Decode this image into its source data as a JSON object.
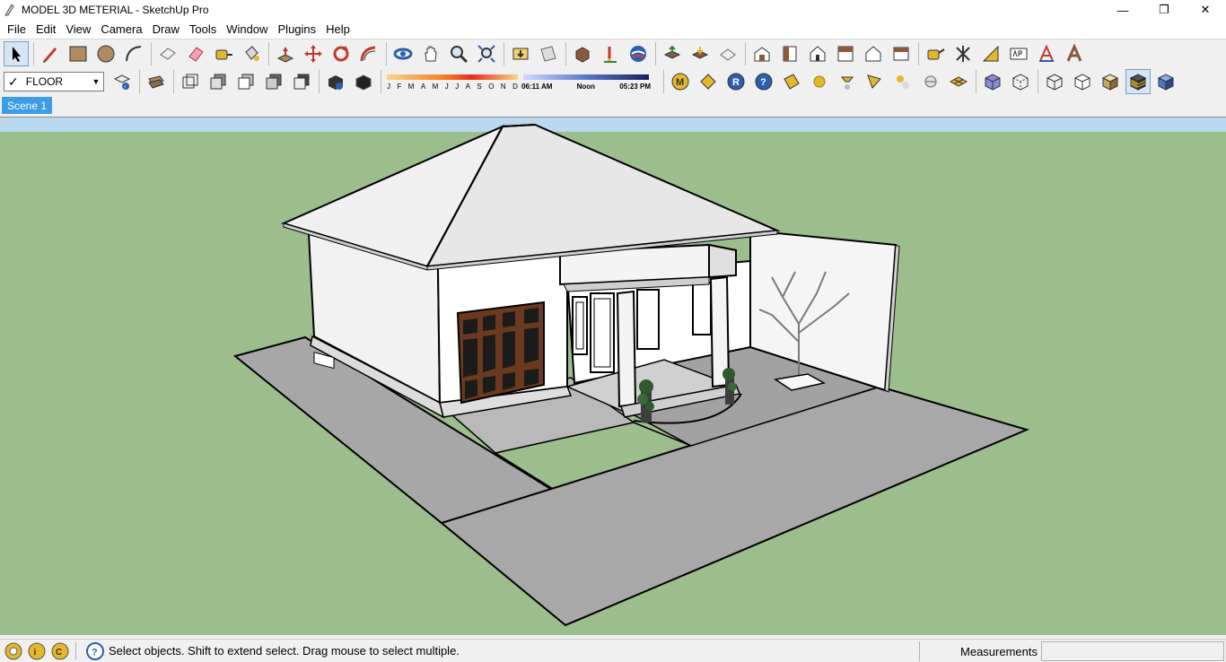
{
  "window": {
    "title": "MODEL 3D METERIAL - SketchUp Pro",
    "app_icon": "sketchup-logo-icon",
    "controls": [
      "minimize-icon",
      "restore-icon",
      "close-icon"
    ]
  },
  "menu": [
    "File",
    "Edit",
    "View",
    "Camera",
    "Draw",
    "Tools",
    "Window",
    "Plugins",
    "Help"
  ],
  "toolbar1": [
    "select-arrow-icon",
    "pencil-icon",
    "rectangle-icon",
    "circle-icon",
    "arc-icon",
    "make-component-icon",
    "eraser-icon",
    "tape-measure-icon",
    "paint-bucket-icon",
    "push-pull-icon",
    "move-icon",
    "rotate-icon",
    "follow-me-icon",
    "orbit-icon",
    "pan-icon",
    "zoom-icon",
    "zoom-extents-icon",
    "get-models-icon",
    "share-model-icon",
    "3d-warehouse-icon",
    "text-icon",
    "google-earth-icon",
    "upload-icon",
    "download-icon",
    "preview-icon",
    "iso-view-icon",
    "front-view-icon",
    "right-view-icon",
    "back-view-icon",
    "left-view-icon",
    "top-view-icon",
    "dimension-icon",
    "axes-icon",
    "protractor-icon",
    "3d-text-icon",
    "section-icon",
    "label-icon"
  ],
  "layer": {
    "current": "FLOOR"
  },
  "shadow": {
    "months": [
      "J",
      "F",
      "M",
      "A",
      "M",
      "J",
      "J",
      "A",
      "S",
      "O",
      "N",
      "D"
    ],
    "time_start": "06:11 AM",
    "time_mid": "Noon",
    "time_end": "05:23 PM"
  },
  "toolbar2_left": [
    "layer-manager-icon",
    "group-icon",
    "wireframe-icon",
    "hidden-line-icon",
    "shaded-icon",
    "textured-icon",
    "monochrome-icon",
    "model-info-icon",
    "components-icon"
  ],
  "toolbar2_right": [
    "m-plugin-icon",
    "tag-icon",
    "r-plugin-icon",
    "help-icon",
    "label-plugin-icon",
    "sphere-icon",
    "lamp-icon",
    "spot-light-icon",
    "omni-light-icon",
    "sun-icon",
    "sandbox-icon",
    "xray-box-icon",
    "back-edges-icon",
    "wireframe-box-icon",
    "hidden-box-icon",
    "shaded-box-icon",
    "textured-box-icon",
    "mono-box-icon"
  ],
  "scene_tab": "Scene 1",
  "status": {
    "message": "Select objects. Shift to extend select. Drag mouse to select multiple.",
    "measurements_label": "Measurements",
    "icons": [
      "geo-location-icon",
      "credits-icon",
      "user-icon"
    ]
  },
  "colors": {
    "ground": "#9cbd8c",
    "sky": "#b8d9ef",
    "pavement": "#a7a7a7",
    "wall": "#ffffff",
    "roof": "#e6e6e6",
    "door": "#6b3a1e",
    "scene_tab": "#3c9ce6"
  }
}
